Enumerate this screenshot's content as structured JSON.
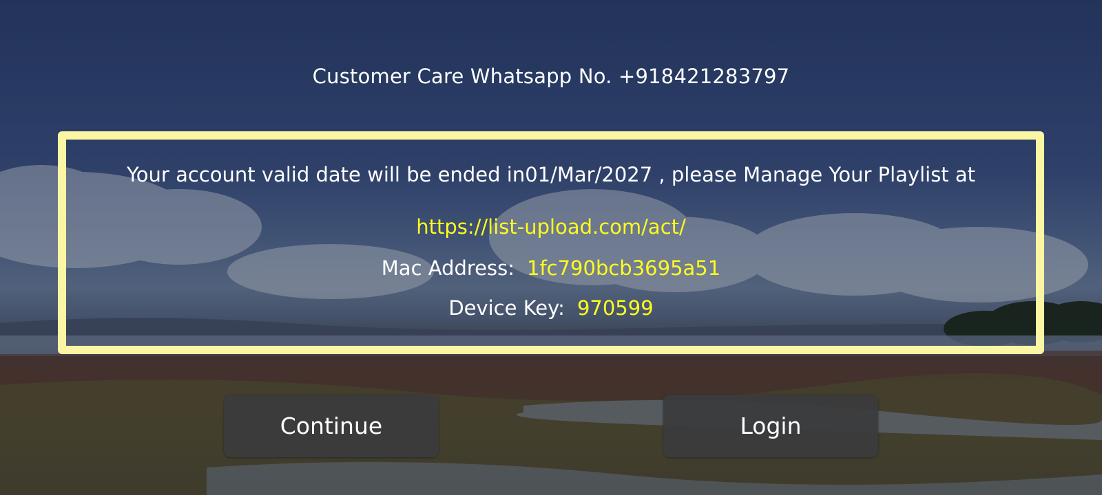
{
  "header": {
    "customer_care": "Customer Care Whatsapp No. +918421283797"
  },
  "info_box": {
    "validity_message": "Your account valid date will be ended in01/Mar/2027 , please Manage Your Playlist at",
    "playlist_url": "https://list-upload.com/act/",
    "mac_label": "Mac Address:",
    "mac_value": "1fc790bcb3695a51",
    "device_key_label": "Device Key:",
    "device_key_value": "970599"
  },
  "buttons": {
    "continue_label": "Continue",
    "login_label": "Login"
  },
  "colors": {
    "box_border": "#fbf6a4",
    "highlight_text": "#fffc1e",
    "button_bg": "#3a3c3e",
    "text": "#ffffff"
  }
}
